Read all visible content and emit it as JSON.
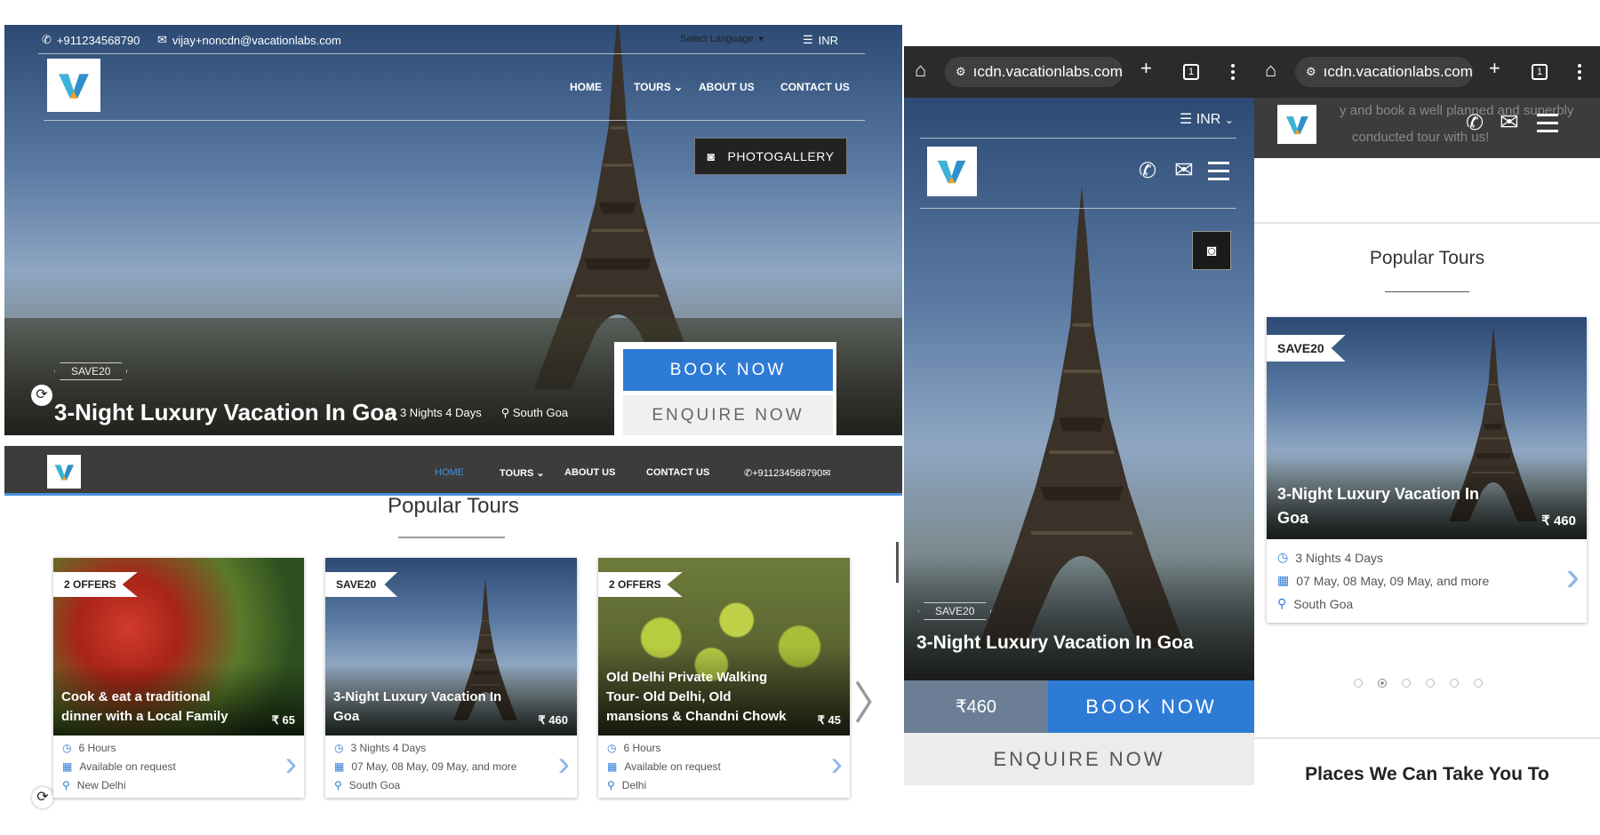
{
  "desktop": {
    "topbar": {
      "phone": "+911234568790",
      "email": "vijay+noncdn@vacationlabs.com",
      "language": "Select Language",
      "currency": "INR"
    },
    "nav": {
      "home": "HOME",
      "tours": "TOURS",
      "about": "ABOUT US",
      "contact": "CONTACT US"
    },
    "photogallery_label": "PHOTOGALLERY",
    "hero": {
      "tag": "SAVE20",
      "title": "3-Night Luxury Vacation In Goa",
      "duration": "3 Nights 4 Days",
      "location": "South Goa"
    },
    "book_now": "BOOK NOW",
    "enquire_now": "ENQUIRE NOW",
    "sticky_nav": {
      "home": "HOME",
      "tours": "TOURS",
      "about": "ABOUT US",
      "contact": "CONTACT US",
      "phone": "+911234568790"
    },
    "popular_title": "Popular Tours",
    "cards": [
      {
        "tag": "2 OFFERS",
        "title": "Cook & eat a traditional dinner with a Local Family",
        "price": "₹ 65",
        "duration": "6 Hours",
        "availability": "Available on request",
        "location": "New Delhi"
      },
      {
        "tag": "SAVE20",
        "title": "3-Night Luxury Vacation In Goa",
        "price": "₹ 460",
        "duration": "3 Nights 4 Days",
        "availability": "07 May, 08 May, 09 May, and more",
        "location": "South Goa"
      },
      {
        "tag": "2 OFFERS",
        "title": "Old Delhi Private Walking Tour- Old Delhi, Old mansions & Chandni Chowk",
        "price": "₹ 45",
        "duration": "6 Hours",
        "availability": "Available on request",
        "location": "Delhi"
      }
    ]
  },
  "mobile1": {
    "url": "ıcdn.vacationlabs.com",
    "tab_count": "1",
    "currency": "INR",
    "tag": "SAVE20",
    "title": "3-Night Luxury Vacation In Goa",
    "price": "₹460",
    "book_now": "BOOK NOW",
    "enquire_now": "ENQUIRE NOW"
  },
  "mobile2": {
    "url": "ıcdn.vacationlabs.com",
    "tab_count": "1",
    "behind_text_1": "y and book a well planned and superbly",
    "behind_text_2": "conducted tour with us!",
    "popular_title": "Popular Tours",
    "card": {
      "tag": "SAVE20",
      "title": "3-Night Luxury Vacation In Goa",
      "price": "₹ 460",
      "duration": "3 Nights 4 Days",
      "availability": "07 May, 08 May, 09 May, and more",
      "location": "South Goa"
    },
    "carousel_active_index": 1,
    "carousel_count": 6,
    "places_title": "Places We Can Take You To"
  },
  "colors": {
    "accent_blue": "#2e7bd6",
    "dark_nav": "#3c3c3c",
    "browser_bar": "#2b2b2b"
  }
}
